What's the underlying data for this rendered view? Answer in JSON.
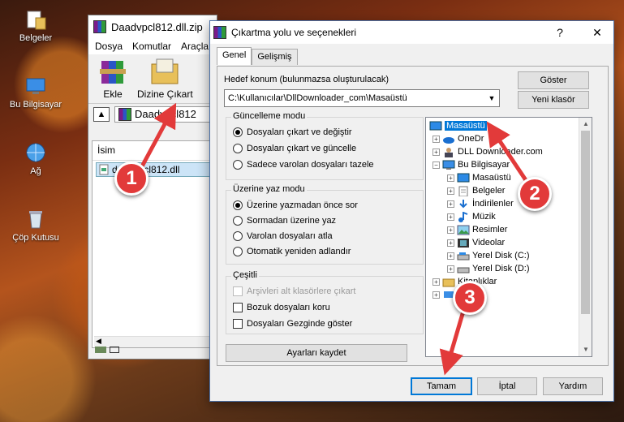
{
  "desktop": {
    "icons": [
      {
        "label": "Belgeler",
        "icon": "folder-documents-icon"
      },
      {
        "label": "Bu Bilgisayar",
        "icon": "computer-icon"
      },
      {
        "label": "Ağ",
        "icon": "network-icon"
      },
      {
        "label": "Çöp Kutusu",
        "icon": "recycle-bin-icon"
      }
    ]
  },
  "winrar": {
    "title": "Daadvpcl812.dll.zip",
    "menu": [
      "Dosya",
      "Komutlar",
      "Araçla"
    ],
    "tools": {
      "extract": "Ekle",
      "extract_to": "Dizine Çıkart"
    },
    "path": "Daadvpcl812",
    "column_name": "İsim",
    "file": "daadvpcl812.dll"
  },
  "dialog": {
    "title": "Çıkartma yolu ve seçenekleri",
    "help": "?",
    "close": "✕",
    "tabs": [
      "Genel",
      "Gelişmiş"
    ],
    "target_label": "Hedef konum (bulunmazsa oluşturulacak)",
    "target_value": "C:\\Kullanıcılar\\DllDownloader_com\\Masaüstü",
    "show_button": "Göster",
    "new_folder_button": "Yeni klasör",
    "update_mode": {
      "title": "Güncelleme modu",
      "options": [
        "Dosyaları çıkart ve değiştir",
        "Dosyaları çıkart ve güncelle",
        "Sadece varolan dosyaları tazele"
      ],
      "selected": 0
    },
    "overwrite_mode": {
      "title": "Üzerine yaz modu",
      "options": [
        "Üzerine yazmadan önce sor",
        "Sormadan üzerine yaz",
        "Varolan dosyaları atla",
        "Otomatik yeniden adlandır"
      ],
      "selected": 0
    },
    "misc": {
      "title": "Çeşitli",
      "options": [
        "Arşivleri alt klasörlere çıkart",
        "Bozuk dosyaları koru",
        "Dosyaları Gezginde göster"
      ]
    },
    "save_settings": "Ayarları kaydet",
    "tree": [
      {
        "label": "Masaüstü",
        "icon": "desktop-icon",
        "selected": true
      },
      {
        "label": "OneDr",
        "icon": "onedrive-icon"
      },
      {
        "label": "DLL Downloader.com",
        "icon": "user-icon"
      },
      {
        "label": "Bu Bilgisayar",
        "icon": "computer-icon"
      },
      {
        "label": "Masaüstü",
        "icon": "desktop-icon"
      },
      {
        "label": "Belgeler",
        "icon": "documents-icon"
      },
      {
        "label": "İndirilenler",
        "icon": "downloads-icon"
      },
      {
        "label": "Müzik",
        "icon": "music-icon"
      },
      {
        "label": "Resimler",
        "icon": "pictures-icon"
      },
      {
        "label": "Videolar",
        "icon": "videos-icon"
      },
      {
        "label": "Yerel Disk (C:)",
        "icon": "disk-icon"
      },
      {
        "label": "Yerel Disk (D:)",
        "icon": "disk-icon"
      },
      {
        "label": "Kitaplıklar",
        "icon": "libraries-icon"
      }
    ],
    "buttons": {
      "ok": "Tamam",
      "cancel": "İptal",
      "help": "Yardım"
    }
  },
  "annotations": {
    "step1": "1",
    "step2": "2",
    "step3": "3",
    "color": "#e23a3a"
  }
}
